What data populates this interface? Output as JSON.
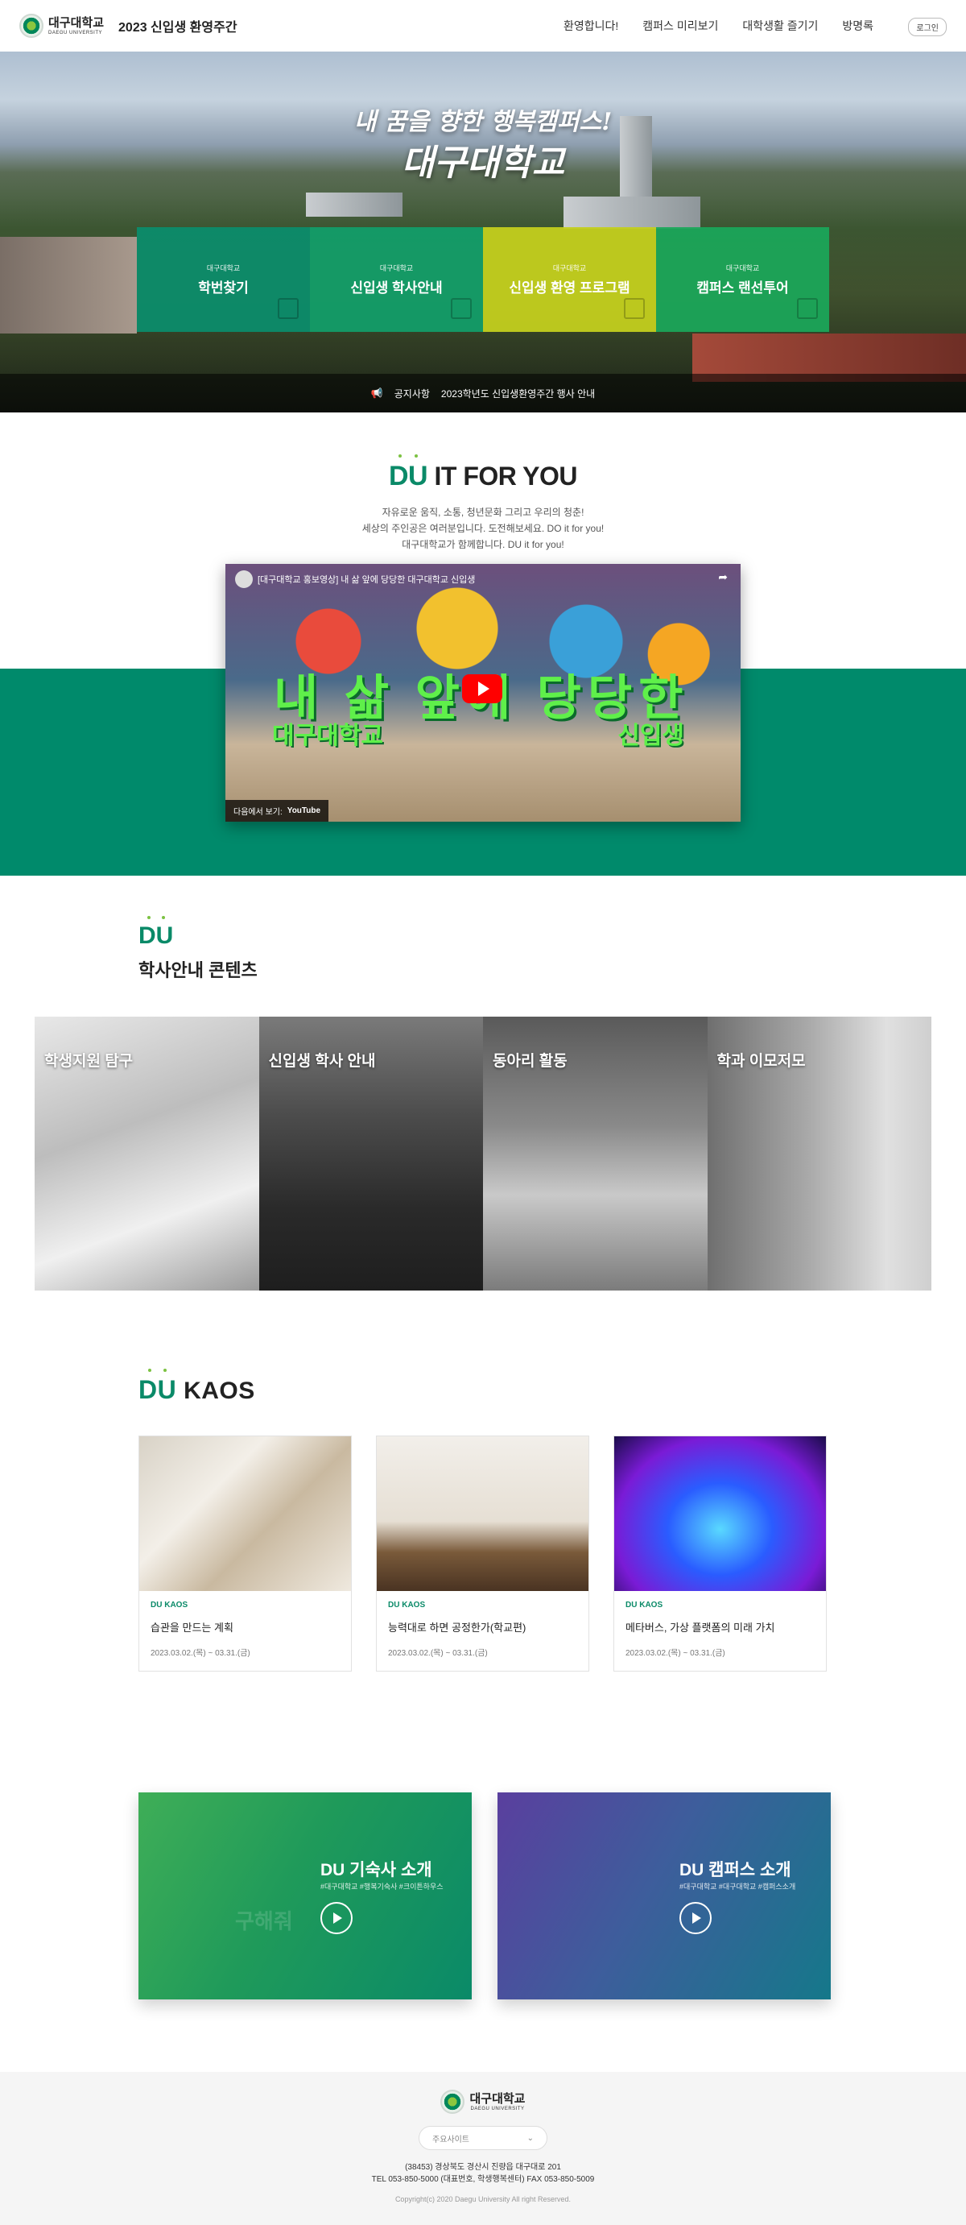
{
  "header": {
    "logo_ko": "대구대학교",
    "logo_en": "DAEGU UNIVERSITY",
    "title": "2023 신입생 환영주간",
    "nav": [
      "환영합니다!",
      "캠퍼스 미리보기",
      "대학생활 즐기기",
      "방명록"
    ],
    "login": "로그인"
  },
  "hero": {
    "tagline1": "내 꿈을 향한 행복캠퍼스!",
    "tagline2": "대구대학교",
    "tiles": [
      {
        "small": "대구대학교",
        "label": "학번찾기",
        "color": "#0a8e6c"
      },
      {
        "small": "대구대학교",
        "label": "신입생 학사안내",
        "color": "#11a06a"
      },
      {
        "small": "대구대학교",
        "label": "신입생 환영 프로그램",
        "color": "#c3cf1e"
      },
      {
        "small": "대구대학교",
        "label": "캠퍼스 랜선투어",
        "color": "#1aa85a"
      }
    ],
    "notice_label": "공지사항",
    "notice_text": "2023학년도 신입생환영주간 행사 안내"
  },
  "du_it": {
    "du": "DU",
    "title": "IT FOR YOU",
    "desc": [
      "자유로운 움직, 소통, 청년문화 그리고 우리의 청춘!",
      "세상의 주인공은 여러분입니다. 도전해보세요. DO it for you!",
      "대구대학교가 함께합니다. DU it for you!"
    ],
    "video": {
      "title": "[대구대학교 홍보영상] 내 삶 앞에 당당한 대구대학교 신입생",
      "big1": "내 삶 앞에 당당한",
      "big2": "대구대학교",
      "big3": "신입생",
      "watch_on": "다음에서 보기:",
      "youtube": "YouTube"
    }
  },
  "academic": {
    "du": "DU",
    "title": "학사안내 콘텐츠",
    "cards": [
      "학생지원 탐구",
      "신입생 학사 안내",
      "동아리 활동",
      "학과 이모저모"
    ]
  },
  "kaos": {
    "du": "DU",
    "title": "KAOS",
    "cards": [
      {
        "category": "DU KAOS",
        "title": "습관을 만드는 계획",
        "date": "2023.03.02.(목) ~ 03.31.(금)"
      },
      {
        "category": "DU KAOS",
        "title": "능력대로 하면 공정한가(학교편)",
        "date": "2023.03.02.(목) ~ 03.31.(금)"
      },
      {
        "category": "DU KAOS",
        "title": "메타버스, 가상 플랫폼의 미래 가치",
        "date": "2023.03.02.(목) ~ 03.31.(금)"
      }
    ]
  },
  "banners": [
    {
      "title": "DU 기숙사 소개",
      "tags": "#대구대학교 #행복기숙사 #크이튼하우스",
      "ghost": "구해줘"
    },
    {
      "title": "DU 캠퍼스 소개",
      "tags": "#대구대학교 #대구대학교 #캠퍼스소개",
      "ghost": ""
    }
  ],
  "footer": {
    "logo_ko": "대구대학교",
    "logo_en": "DAEGU UNIVERSITY",
    "select": "주요사이트",
    "address": "(38453) 경상북도 경산시 진량읍 대구대로 201",
    "tel": "TEL 053-850-5000 (대표번호, 학생행복센터) FAX 053-850-5009",
    "copyright": "Copyright(c) 2020 Daegu University All right Reserved."
  },
  "colors": {
    "brand": "#0a8a68",
    "band": "#008a6b",
    "accent": "#7cc242"
  }
}
